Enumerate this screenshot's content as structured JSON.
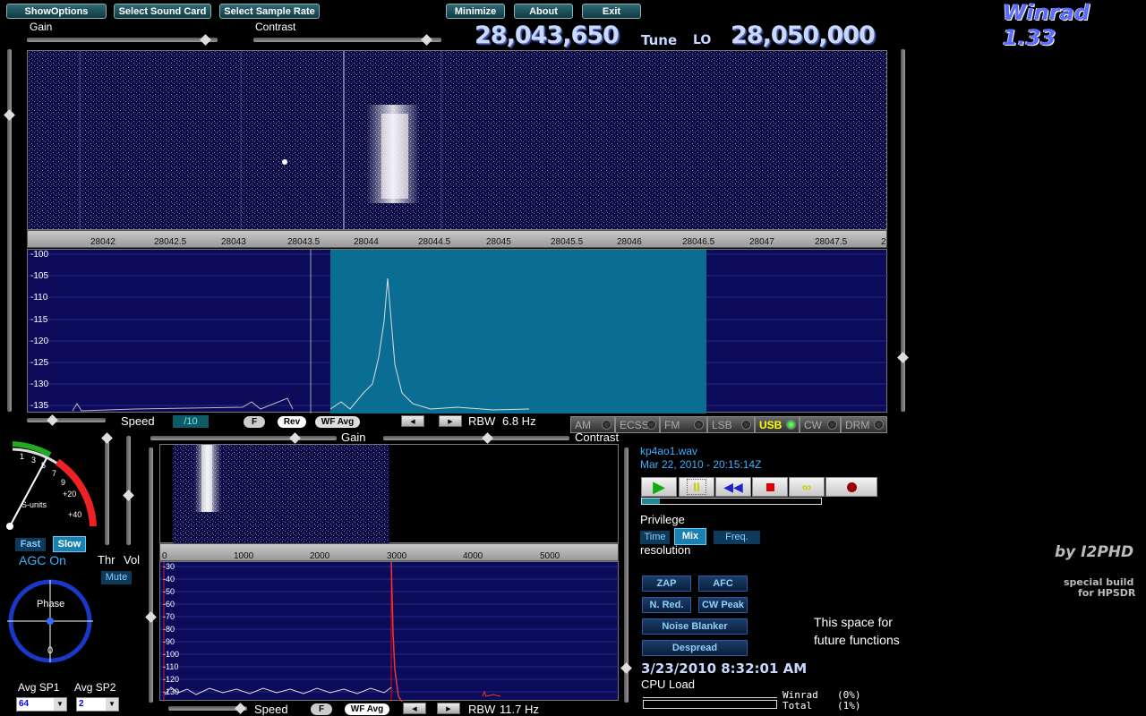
{
  "app": {
    "title": "Winrad 1.33",
    "byline": "by I2PHD",
    "build_line1": "special build",
    "build_line2": "for HPSDR"
  },
  "toolbar": {
    "show_options": "ShowOptions",
    "select_sound_card": "Select Sound Card",
    "select_sample_rate": "Select Sample Rate",
    "minimize": "Minimize",
    "about": "About",
    "exit": "Exit"
  },
  "top_sliders": {
    "gain": "Gain",
    "contrast": "Contrast"
  },
  "frequency": {
    "tune_value": "28,043,650",
    "tune_label": "Tune",
    "lo_label": "LO",
    "lo_value": "28,050,000"
  },
  "main_axis": {
    "ticks": [
      "28042",
      "28042.5",
      "28043",
      "28043.5",
      "28044",
      "28044.5",
      "28045",
      "28045.5",
      "28046",
      "28046.5",
      "28047",
      "28047.5",
      "2"
    ]
  },
  "main_spectrum": {
    "ylabels": [
      "-100",
      "-105",
      "-110",
      "-115",
      "-120",
      "-125",
      "-130",
      "-135"
    ]
  },
  "main_controls": {
    "speed": "Speed",
    "speed_div": "/10",
    "f": "F",
    "rev": "Rev",
    "wf_avg": "WF Avg",
    "rbw_label": "RBW",
    "rbw_value": "6.8 Hz"
  },
  "modes": {
    "am": "AM",
    "ecss": "ECSS",
    "fm": "FM",
    "lsb": "LSB",
    "usb": "USB",
    "cw": "CW",
    "drm": "DRM"
  },
  "meter": {
    "scale": [
      "1",
      "3",
      "5",
      "7",
      "9",
      "+20",
      "+40"
    ],
    "unit": "S-units",
    "fast": "Fast",
    "slow": "Slow",
    "agc": "AGC On",
    "thr": "Thr",
    "vol": "Vol",
    "mute": "Mute",
    "phase": "Phase",
    "phase_zero": "0"
  },
  "avg": {
    "sp1_label": "Avg SP1",
    "sp1_value": "64",
    "sp2_label": "Avg SP2",
    "sp2_value": "2"
  },
  "audio": {
    "gain": "Gain",
    "contrast": "Contrast",
    "axis_ticks": [
      "0",
      "1000",
      "2000",
      "3000",
      "4000",
      "5000"
    ],
    "ylabels": [
      "-30",
      "-40",
      "-50",
      "-60",
      "-70",
      "-80",
      "-90",
      "-100",
      "-110",
      "-120",
      "-130"
    ],
    "speed": "Speed",
    "f": "F",
    "wf_avg": "WF Avg",
    "rbw_label": "RBW",
    "rbw_value": "11.7 Hz"
  },
  "file": {
    "name": "kp4ao1.wav",
    "timestamp": "Mar 22, 2010 - 20:15:14Z"
  },
  "privilege": {
    "title": "Privilege",
    "time": "Time",
    "mix": "Mix",
    "freq": "Freq.",
    "resolution": "resolution"
  },
  "functions": {
    "zap": "ZAP",
    "afc": "AFC",
    "nred": "N. Red.",
    "cwpeak": "CW Peak",
    "noise_blanker": "Noise Blanker",
    "despread": "Despread",
    "future_line1": "This space for",
    "future_line2": "future functions"
  },
  "status": {
    "datetime": "3/23/2010 8:32:01 AM",
    "cpu_load": "CPU Load",
    "winrad": "Winrad",
    "winrad_pct": "(0%)",
    "total": "Total",
    "total_pct": "(1%)"
  },
  "colors": {
    "accent": "#1a7fa0",
    "passband": "#0a6e92",
    "spectrum_bg": "#0b0b5a"
  }
}
